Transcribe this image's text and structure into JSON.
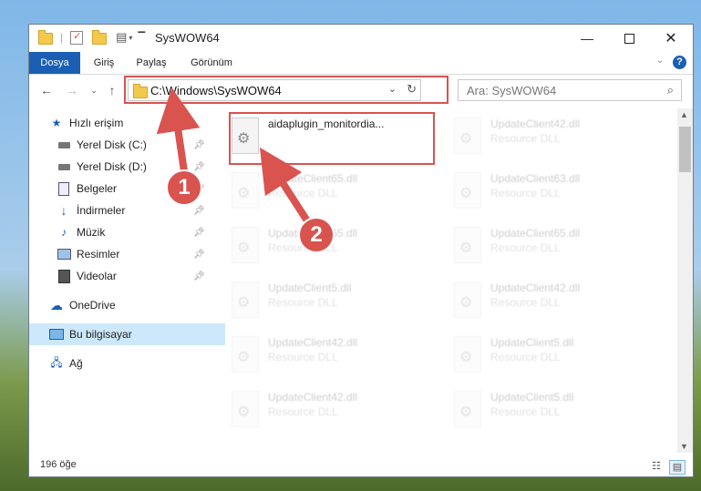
{
  "window": {
    "title": "SysWOW64"
  },
  "ribbon": {
    "tabs": [
      "Dosya",
      "Giriş",
      "Paylaş",
      "Görünüm"
    ]
  },
  "address": {
    "path": "C:\\Windows\\SysWOW64",
    "search_placeholder": "Ara: SysWOW64"
  },
  "nav": {
    "items": [
      {
        "label": "Hızlı erişim",
        "icon": "star-icon"
      },
      {
        "label": "Yerel Disk (C:)",
        "icon": "drive-icon",
        "pinned": true
      },
      {
        "label": "Yerel Disk (D:)",
        "icon": "drive-icon",
        "pinned": true
      },
      {
        "label": "Belgeler",
        "icon": "document-icon",
        "pinned": true
      },
      {
        "label": "İndirmeler",
        "icon": "download-icon",
        "pinned": true
      },
      {
        "label": "Müzik",
        "icon": "music-icon",
        "pinned": true
      },
      {
        "label": "Resimler",
        "icon": "pictures-icon",
        "pinned": true
      },
      {
        "label": "Videolar",
        "icon": "video-icon",
        "pinned": true
      },
      {
        "label": "OneDrive",
        "icon": "cloud-icon"
      },
      {
        "label": "Bu bilgisayar",
        "icon": "computer-icon",
        "selected": true
      },
      {
        "label": "Ağ",
        "icon": "network-icon"
      }
    ]
  },
  "files": [
    {
      "name": "aidaplugin_monitordia...",
      "desc": "",
      "highlighted": true
    },
    {
      "name": "UpdateClient42.dll",
      "desc": "Resource DLL"
    },
    {
      "name": "UpdateClient65.dll",
      "desc": "Resource DLL"
    },
    {
      "name": "UpdateClient63.dll",
      "desc": "Resource DLL"
    },
    {
      "name": "UpdateClient65.dll",
      "desc": "Resource DLL"
    },
    {
      "name": "UpdateClient65.dll",
      "desc": "Resource DLL"
    },
    {
      "name": "UpdateClient5.dll",
      "desc": "Resource DLL"
    },
    {
      "name": "UpdateClient42.dll",
      "desc": "Resource DLL"
    },
    {
      "name": "UpdateClient42.dll",
      "desc": "Resource DLL"
    },
    {
      "name": "UpdateClient5.dll",
      "desc": "Resource DLL"
    },
    {
      "name": "UpdateClient42.dll",
      "desc": "Resource DLL"
    },
    {
      "name": "UpdateClient5.dll",
      "desc": "Resource DLL"
    }
  ],
  "status": {
    "count": "196 öğe"
  },
  "callouts": [
    "1",
    "2"
  ],
  "colors": {
    "accent": "#1a5fb4",
    "highlight": "#d9534f",
    "selected": "#cde8fa"
  }
}
